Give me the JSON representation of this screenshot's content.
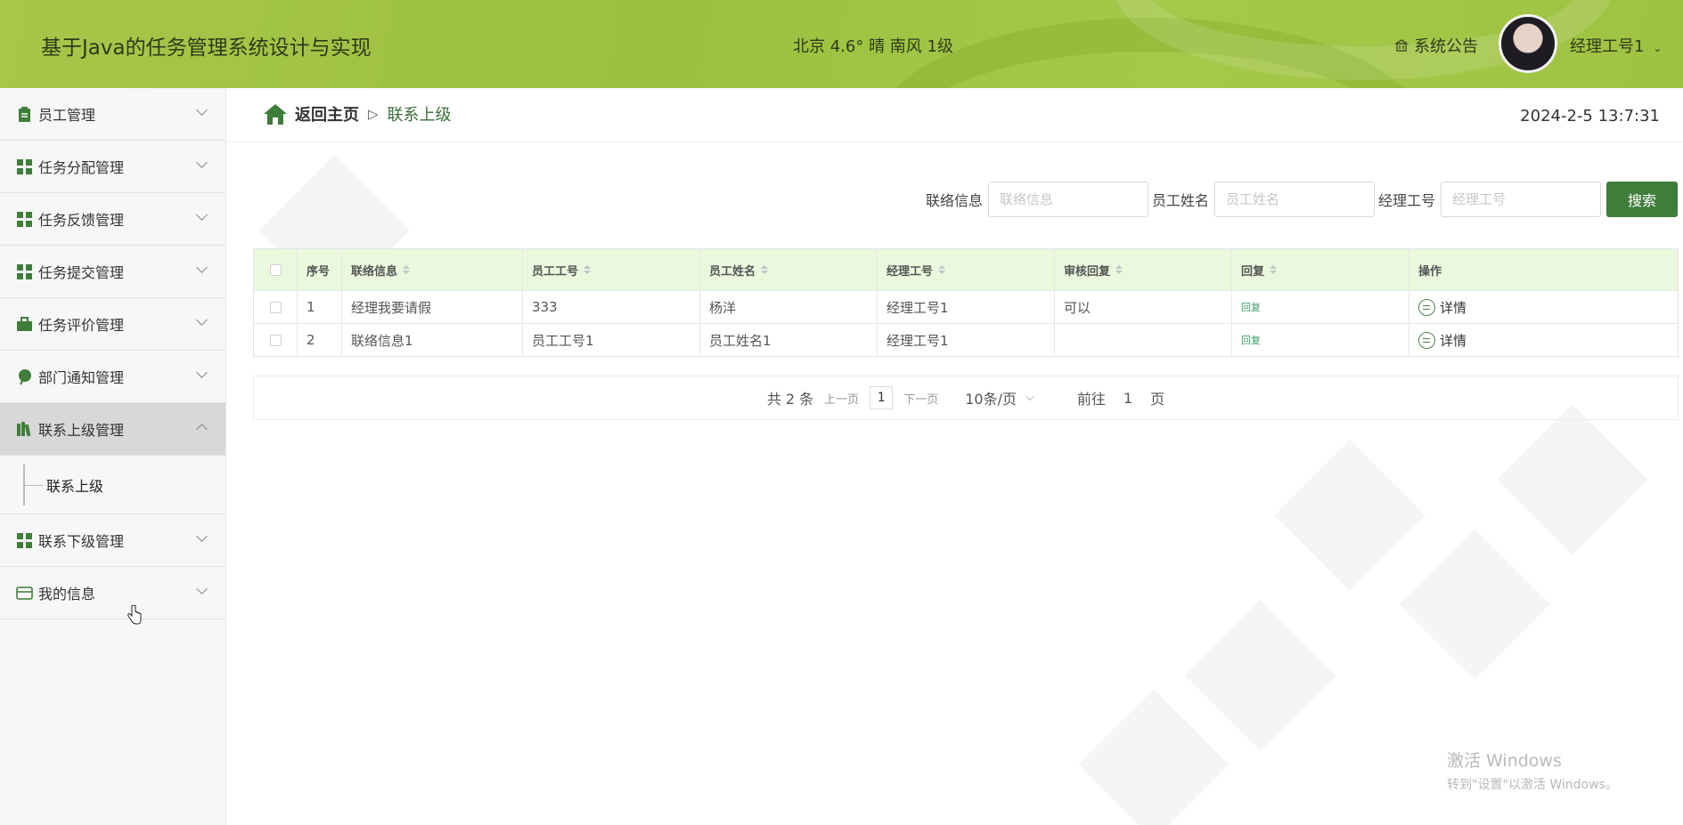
{
  "header": {
    "title": "基于Java的任务管理系统设计与实现",
    "weather": "北京  4.6°  晴  南风  1级",
    "notice_label": "系统公告",
    "user_label": "经理工号1",
    "colors": {
      "header_bg": "#a2c445",
      "accent": "#3e7d3a",
      "table_header_bg": "#eaf8dd"
    }
  },
  "sidebar": {
    "items": [
      {
        "label": "员工管理",
        "icon": "clipboard-icon"
      },
      {
        "label": "任务分配管理",
        "icon": "grid-icon"
      },
      {
        "label": "任务反馈管理",
        "icon": "grid-icon"
      },
      {
        "label": "任务提交管理",
        "icon": "grid-icon"
      },
      {
        "label": "任务评价管理",
        "icon": "briefcase-icon"
      },
      {
        "label": "部门通知管理",
        "icon": "leaf-icon"
      },
      {
        "label": "联系上级管理",
        "icon": "books-icon"
      },
      {
        "label": "联系下级管理",
        "icon": "grid-icon"
      },
      {
        "label": "我的信息",
        "icon": "card-icon"
      }
    ],
    "active_sub": "联系上级"
  },
  "breadcrumb": {
    "home": "返回主页",
    "separator": "▷",
    "current": "联系上级"
  },
  "datetime": "2024-2-5 13:7:31",
  "search": {
    "fields": [
      {
        "label": "联络信息",
        "placeholder": "联络信息",
        "value": ""
      },
      {
        "label": "员工姓名",
        "placeholder": "员工姓名",
        "value": ""
      },
      {
        "label": "经理工号",
        "placeholder": "经理工号",
        "value": ""
      }
    ],
    "button": "搜索"
  },
  "table": {
    "columns": [
      "序号",
      "联络信息",
      "员工工号",
      "员工姓名",
      "经理工号",
      "审核回复",
      "回复",
      "操作"
    ],
    "rows": [
      {
        "index": "1",
        "contact": "经理我要请假",
        "emp_no": "333",
        "emp_name": "杨洋",
        "mgr_no": "经理工号1",
        "review": "可以",
        "reply": "回复",
        "action": "详情"
      },
      {
        "index": "2",
        "contact": "联络信息1",
        "emp_no": "员工工号1",
        "emp_name": "员工姓名1",
        "mgr_no": "经理工号1",
        "review": "",
        "reply": "回复",
        "action": "详情"
      }
    ]
  },
  "pager": {
    "total": "共 2 条",
    "prev": "上一页",
    "page": "1",
    "next": "下一页",
    "size": "10条/页",
    "goto_label": "前往",
    "goto_value": "1",
    "page_suffix": "页"
  },
  "watermark": {
    "line1": "激活 Windows",
    "line2": "转到\"设置\"以激活 Windows。"
  }
}
